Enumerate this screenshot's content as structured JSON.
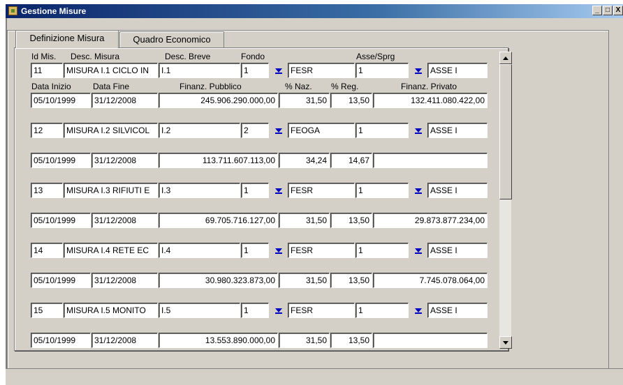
{
  "window": {
    "title": "Gestione Misure",
    "min": "_",
    "max": "□",
    "close": "X"
  },
  "tabs": [
    {
      "label": "Definizione Misura"
    },
    {
      "label": "Quadro Economico"
    }
  ],
  "headers": {
    "id_mis": "Id Mis.",
    "desc_misura": "Desc. Misura",
    "desc_breve": "Desc. Breve",
    "fondo": "Fondo",
    "asse_sprg": "Asse/Sprg",
    "data_inizio": "Data Inizio",
    "data_fine": "Data Fine",
    "finanz_pubblico": "Finanz. Pubblico",
    "perc_naz": "% Naz.",
    "perc_reg": "% Reg.",
    "finanz_privato": "Finanz. Privato"
  },
  "records": [
    {
      "id": "11",
      "desc": "MISURA I.1 CICLO IN",
      "breve": "I.1",
      "fondo_code": "1",
      "fondo_name": "FESR",
      "asse_code": "1",
      "asse_name": "ASSE I",
      "data_inizio": "05/10/1999",
      "data_fine": "31/12/2008",
      "pubblico": "245.906.290.000,00",
      "naz": "31,50",
      "reg": "13,50",
      "privato": "132.411.080.422,00"
    },
    {
      "id": "12",
      "desc": "MISURA I.2 SILVICOL",
      "breve": "I.2",
      "fondo_code": "2",
      "fondo_name": "FEOGA",
      "asse_code": "1",
      "asse_name": "ASSE I",
      "data_inizio": "05/10/1999",
      "data_fine": "31/12/2008",
      "pubblico": "113.711.607.113,00",
      "naz": "34,24",
      "reg": "14,67",
      "privato": ""
    },
    {
      "id": "13",
      "desc": "MISURA I.3 RIFIUTI E",
      "breve": "I.3",
      "fondo_code": "1",
      "fondo_name": "FESR",
      "asse_code": "1",
      "asse_name": "ASSE I",
      "data_inizio": "05/10/1999",
      "data_fine": "31/12/2008",
      "pubblico": "69.705.716.127,00",
      "naz": "31,50",
      "reg": "13,50",
      "privato": "29.873.877.234,00"
    },
    {
      "id": "14",
      "desc": "MISURA I.4 RETE EC",
      "breve": "I.4",
      "fondo_code": "1",
      "fondo_name": "FESR",
      "asse_code": "1",
      "asse_name": "ASSE I",
      "data_inizio": "05/10/1999",
      "data_fine": "31/12/2008",
      "pubblico": "30.980.323.873,00",
      "naz": "31,50",
      "reg": "13,50",
      "privato": "7.745.078.064,00"
    },
    {
      "id": "15",
      "desc": "MISURA I.5 MONITO",
      "breve": "I.5",
      "fondo_code": "1",
      "fondo_name": "FESR",
      "asse_code": "1",
      "asse_name": "ASSE I",
      "data_inizio": "05/10/1999",
      "data_fine": "31/12/2008",
      "pubblico": "13.553.890.000,00",
      "naz": "31,50",
      "reg": "13,50",
      "privato": ""
    }
  ],
  "colors": {
    "title_start": "#0a246a",
    "title_end": "#a6caf0",
    "face": "#d4d0c8",
    "dropdown_arrow": "#0000c0"
  },
  "icons": {
    "app": "app-icon",
    "dropdown": "dropdown-arrow-icon",
    "scroll_up": "scroll-up-icon",
    "scroll_down": "scroll-down-icon"
  }
}
